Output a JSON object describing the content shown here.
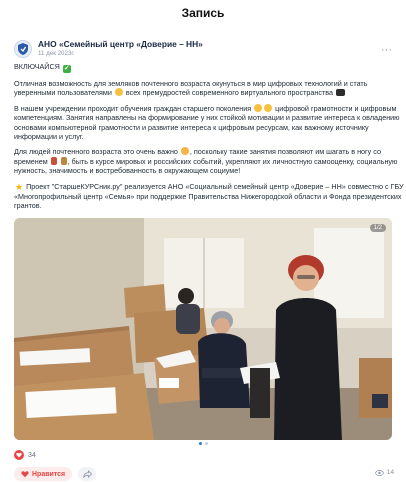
{
  "header": {
    "title": "Запись"
  },
  "post": {
    "author": "АНО «Семейный центр «Доверие – НН»",
    "date": "11 дек 2023г.",
    "more_icon": "more-dots-icon",
    "paragraphs": {
      "p1": "ВКЛЮЧАЙСЯ",
      "p2": "Отличная возможность для земляков почтенного возраста окунуться в мир цифровых технологий и стать уверенными пользователями",
      "p2b": "всех премудростей современного виртуального пространства",
      "p3a": "В нашем учреждении проходит обучения граждан старшего поколения",
      "p3b": "цифровой грамотности и цифровым компетенциям. Занятия направлены на формирование у них стойкой мотивации и развитие интереса к овладению основами компьютерной грамотности и развитие интереса к цифровым ресурсам, как важному источнику информации и услуг.",
      "p4a": "Для людей почтенного возраста это очень важно",
      "p4b": ", поскольку такие занятия позволяют им шагать в ногу со временем",
      "p4c": ", быть в курсе мировых и российских событий, укрепляют их личностную самооценку, социальную нужность, значимость и востребованность в окружающем социуме!",
      "p5": "Проект \"СтаршеКУРСник.ру\" реализуется АНО «Социальный семейный центр «Доверие – НН» совместно с ГБУ «Многопрофильный центр «Семья» при поддержке Правительства Нижегородской области и Фонда президентских грантов."
    },
    "photo": {
      "counter": "1/2",
      "alt_icon": "classroom-photo"
    },
    "likes_count": "34",
    "like_label": "Нравится",
    "views": "14"
  },
  "colors": {
    "accent": "#e64646",
    "link": "#2c7be5"
  }
}
